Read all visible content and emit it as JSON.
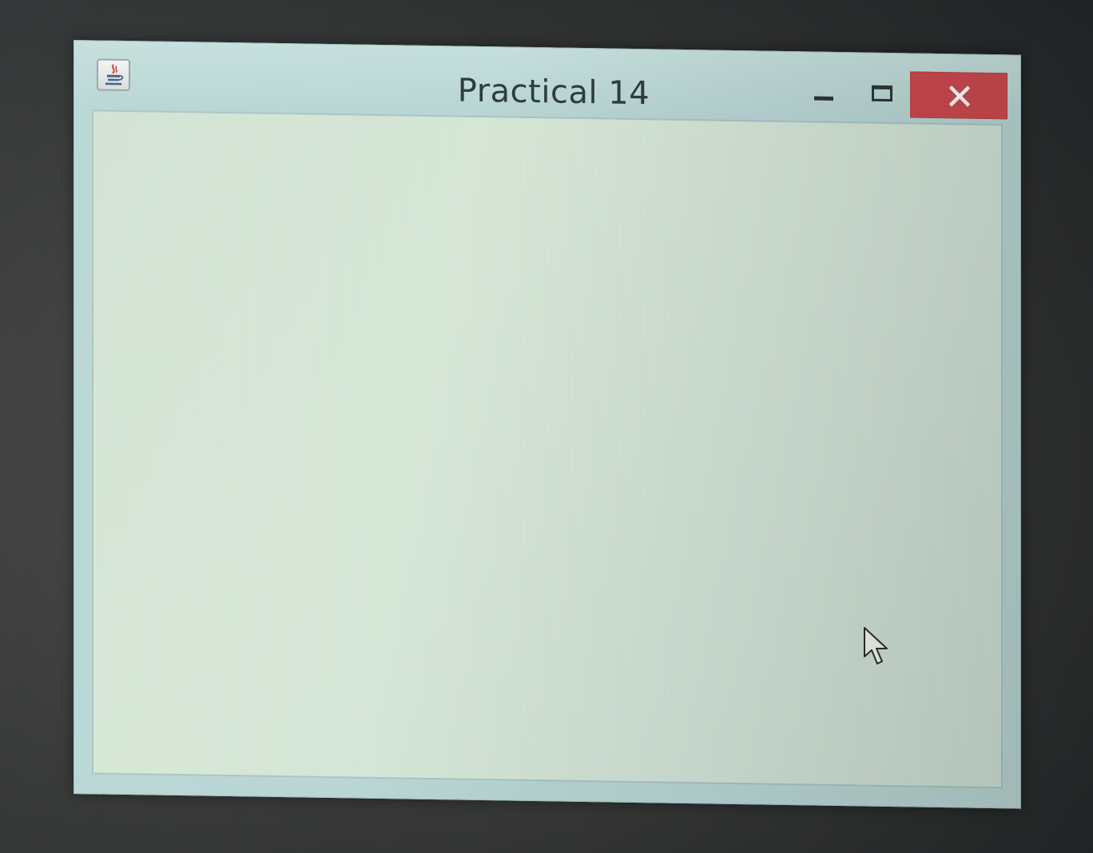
{
  "window": {
    "title": "Practical 14",
    "app_icon": "java-cup-icon",
    "controls": {
      "minimize_icon": "minimize-icon",
      "maximize_icon": "maximize-icon",
      "close_icon": "close-icon",
      "close_color": "#cc4a4f"
    },
    "client_area": {
      "background_color": "#d6e6d8"
    }
  },
  "cursor": {
    "icon": "arrow-cursor-icon"
  }
}
